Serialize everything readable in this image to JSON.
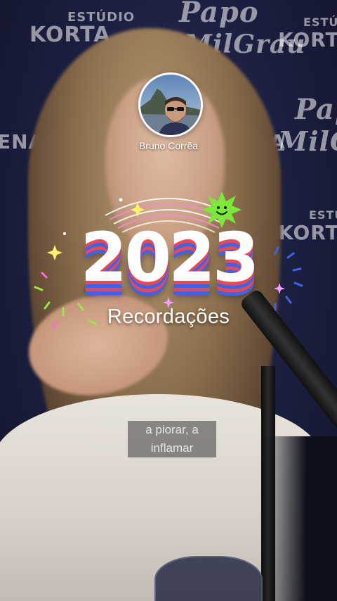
{
  "backdrop": {
    "brand_a_line1": "ESTÚDIO",
    "brand_a_line2": "KORTA",
    "brand_b_line1": "Papo",
    "brand_b_line2": "MilGrau",
    "brand_c": "ENA",
    "brand_d": "CENA"
  },
  "profile": {
    "name": "Bruno Corrêa",
    "avatar_icon": "profile-photo-icon"
  },
  "recap": {
    "year": "2023",
    "subtitle": "Recordações",
    "colors": {
      "red": "#e64a55",
      "blue": "#3e63e8",
      "sticker": "#7be83a"
    }
  },
  "video": {
    "caption_line1": "a piorar, a",
    "caption_line2": "inflamar"
  }
}
